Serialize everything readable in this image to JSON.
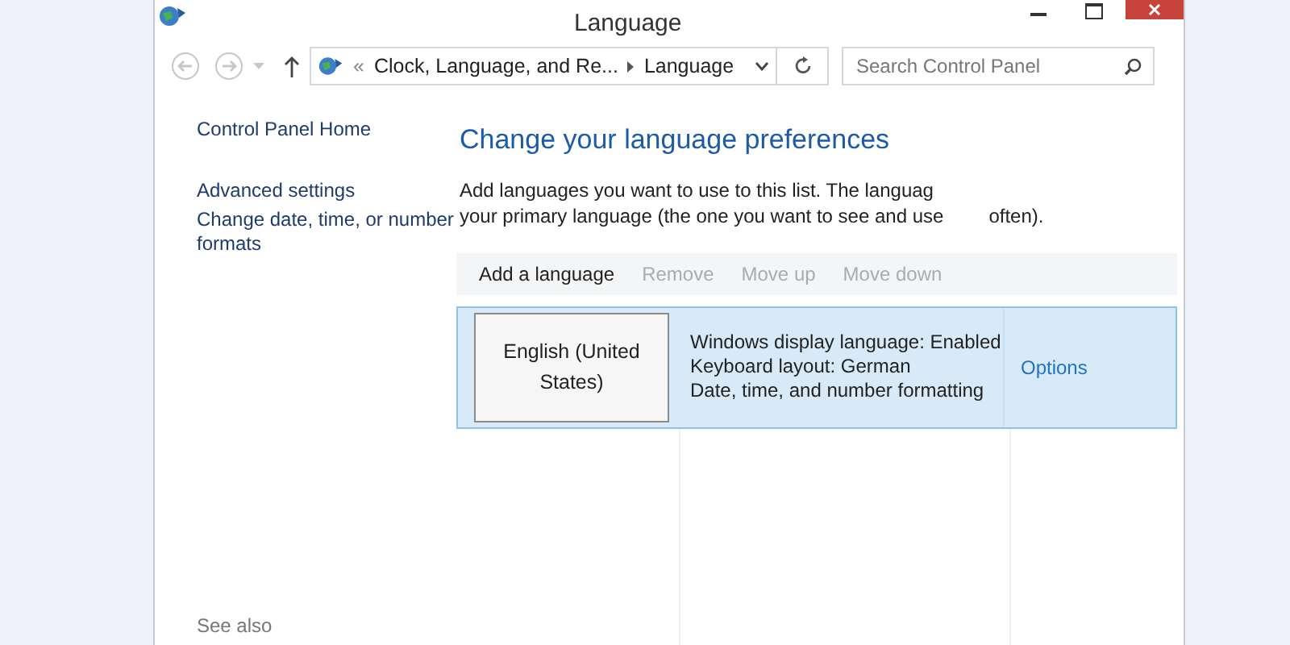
{
  "window": {
    "title": "Language"
  },
  "address_bar": {
    "overflow": "«",
    "crumbs": [
      "Clock, Language, and Re...",
      "Language"
    ]
  },
  "search": {
    "placeholder": "Search Control Panel"
  },
  "sidebar": {
    "items": [
      "Control Panel Home",
      "Advanced settings",
      "Change date, time, or number formats"
    ],
    "see_also": "See also"
  },
  "heading": "Change your language preferences",
  "description": [
    "Add languages you want to use to this list. The languag",
    "your primary language (the one you want to see and use",
    "often)."
  ],
  "toolbar": [
    {
      "label": "Add a language",
      "disabled": false
    },
    {
      "label": "Remove",
      "disabled": true
    },
    {
      "label": "Move up",
      "disabled": true
    },
    {
      "label": "Move down",
      "disabled": true
    }
  ],
  "languages": [
    {
      "name": "English (United States)",
      "selected": true,
      "details": [
        "Windows display language: Enabled",
        "Keyboard layout: German",
        "Date, time, and number formatting"
      ],
      "options": "Options"
    }
  ]
}
